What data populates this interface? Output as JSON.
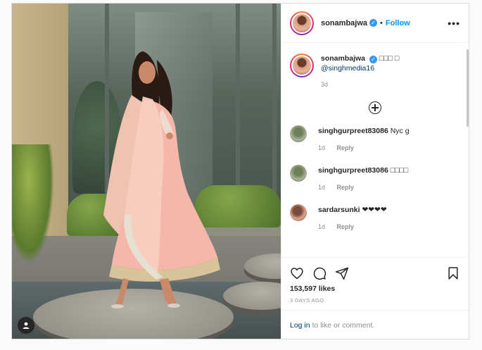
{
  "post": {
    "author": "sonambajwa",
    "follow_label": "Follow",
    "separator": "•",
    "more_label": "•••"
  },
  "caption": {
    "username": "sonambajwa",
    "text": "□□□ □",
    "mention": "@singhmedia16",
    "age": "3d"
  },
  "comments": [
    {
      "username": "singhgurpreet83086",
      "text": "Nyc g",
      "age": "1d",
      "reply_label": "Reply"
    },
    {
      "username": "singhgurpreet83086",
      "text": "□□□□",
      "age": "1d",
      "reply_label": "Reply"
    },
    {
      "username": "sardarsunki",
      "text": "❤❤❤❤",
      "age": "1d",
      "reply_label": "Reply"
    }
  ],
  "stats": {
    "likes": "153,597 likes",
    "timestamp": "3 DAYS AGO"
  },
  "login": {
    "link_label": "Log in",
    "rest_label": "to like or comment."
  },
  "icons": {
    "like": "heart-icon",
    "comment": "comment-icon",
    "share": "share-icon",
    "save": "bookmark-icon",
    "user_tag": "user-icon",
    "load_more": "plus-circle-icon"
  },
  "colors": {
    "accent": "#0095f6",
    "verified": "#3897f0",
    "muted": "#8e8e8e",
    "border": "#dbdbdb"
  }
}
